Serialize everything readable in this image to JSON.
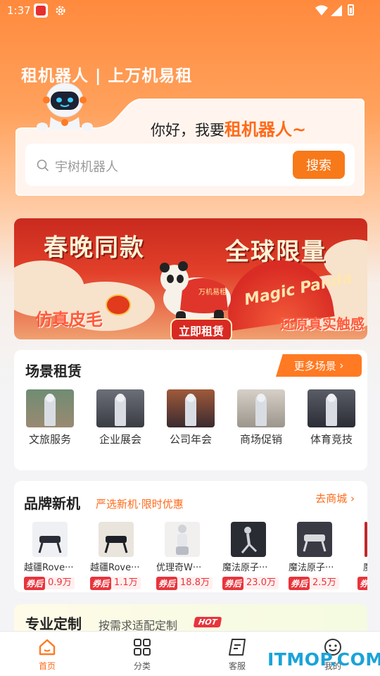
{
  "status_bar": {
    "time": "1:37"
  },
  "header": {
    "headline": "租机器人 | 上万机易租"
  },
  "search": {
    "greeting_prefix": "你好，我要",
    "greeting_highlight": "租机器人~",
    "placeholder": "宇树机器人",
    "button": "搜索"
  },
  "banner": {
    "text_left": "春晚同款",
    "text_right": "全球限量",
    "text_bottom_left": "仿真皮毛",
    "text_bottom_right": "还原真实触感",
    "fan_text": "Magic Panda",
    "badge_text": "万机易租",
    "cta": "立即租赁"
  },
  "scenes": {
    "title": "场景租赁",
    "more": "更多场景",
    "items": [
      {
        "label": "文旅服务"
      },
      {
        "label": "企业展会"
      },
      {
        "label": "公司年会"
      },
      {
        "label": "商场促销"
      },
      {
        "label": "体育竞技"
      }
    ]
  },
  "brand": {
    "title": "品牌新机",
    "subtitle": "严选新机·限时优惠",
    "go_mall": "去商城",
    "items": [
      {
        "name": "越疆Rove···",
        "tag": "券后",
        "price": "0.9万"
      },
      {
        "name": "越疆Rove···",
        "tag": "券后",
        "price": "1.1万"
      },
      {
        "name": "优理奇W···",
        "tag": "券后",
        "price": "18.8万"
      },
      {
        "name": "魔法原子···",
        "tag": "券后",
        "price": "23.0万"
      },
      {
        "name": "魔法原子···",
        "tag": "券后",
        "price": "2.5万"
      },
      {
        "name": "魔",
        "tag": "券",
        "price": ""
      }
    ]
  },
  "custom": {
    "title": "专业定制",
    "subtitle": "按需求适配定制",
    "hot": "HOT"
  },
  "tabbar": {
    "items": [
      {
        "label": "首页",
        "icon": "home-icon",
        "active": true
      },
      {
        "label": "分类",
        "icon": "grid-icon"
      },
      {
        "label": "客服",
        "icon": "chat-icon"
      },
      {
        "label": "我的",
        "icon": "profile-icon"
      }
    ]
  },
  "watermark": "ITMOP.COM",
  "colors": {
    "accent": "#ff7a22",
    "price_red": "#e8343c",
    "watermark": "#1aa3d8"
  }
}
